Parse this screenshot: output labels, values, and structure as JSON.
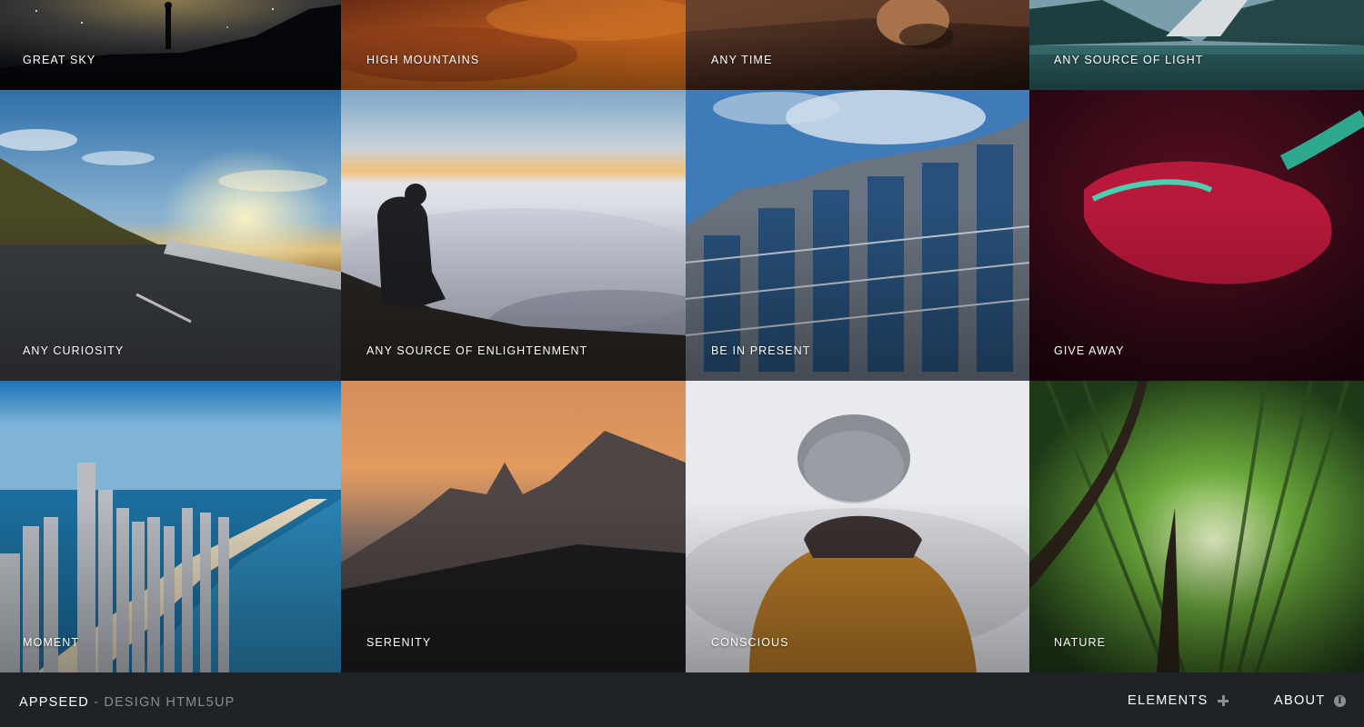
{
  "gallery": {
    "tiles": [
      {
        "label": "Great Sky"
      },
      {
        "label": "High Mountains"
      },
      {
        "label": "Any Time"
      },
      {
        "label": "Any Source of Light"
      },
      {
        "label": "Any Curiosity"
      },
      {
        "label": "Any Source of Enlightenment"
      },
      {
        "label": "Be in Present"
      },
      {
        "label": "Give Away"
      },
      {
        "label": "Moment"
      },
      {
        "label": "Serenity"
      },
      {
        "label": "Conscious"
      },
      {
        "label": "Nature"
      }
    ]
  },
  "footer": {
    "brand": "AppSeed",
    "brand_sub": " - Design HTML5UP",
    "nav": [
      {
        "label": "Elements",
        "icon": "plus-icon"
      },
      {
        "label": "About",
        "icon": "info-icon"
      }
    ]
  },
  "colors": {
    "footer_bg": "#1f2226",
    "muted": "#8a8d91"
  }
}
